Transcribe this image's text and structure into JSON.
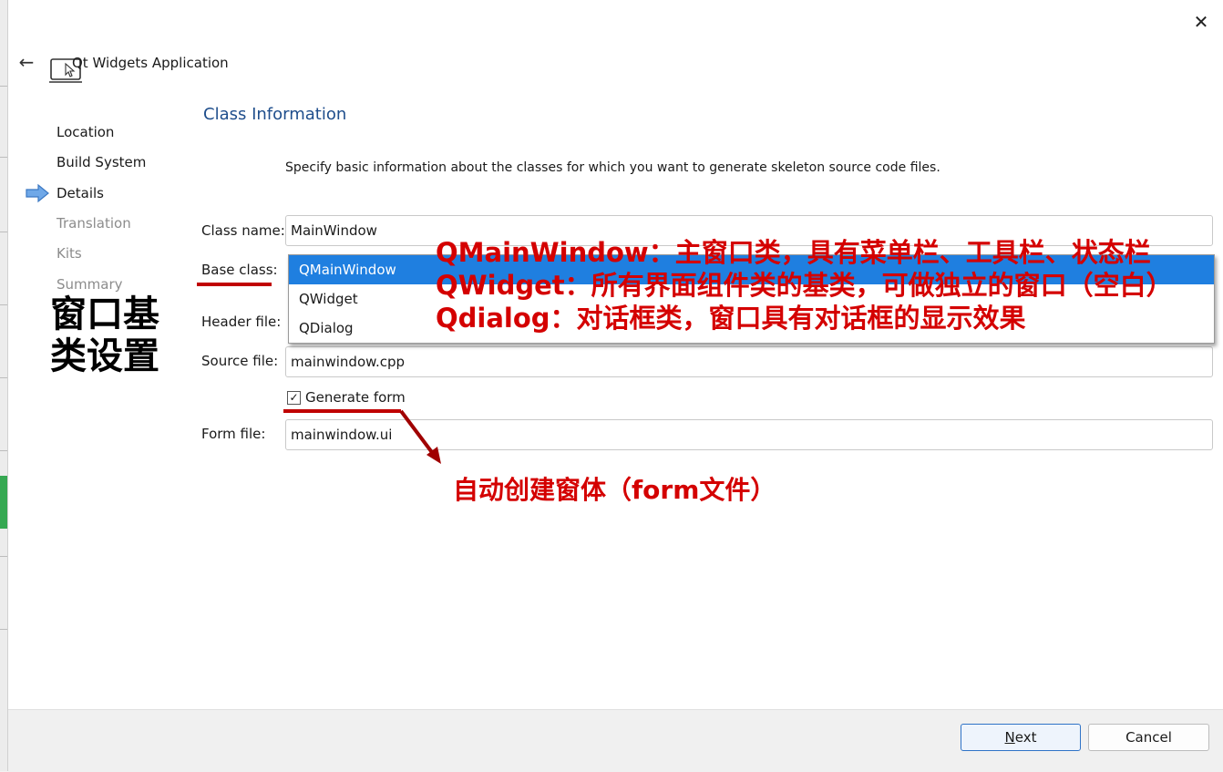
{
  "window": {
    "title": "Qt Widgets Application",
    "close_icon": "✕",
    "back_icon": "←"
  },
  "nav": {
    "items": [
      {
        "label": "Location",
        "state": "done"
      },
      {
        "label": "Build System",
        "state": "done"
      },
      {
        "label": "Details",
        "state": "current"
      },
      {
        "label": "Translation",
        "state": "pending"
      },
      {
        "label": "Kits",
        "state": "pending"
      },
      {
        "label": "Summary",
        "state": "pending"
      }
    ]
  },
  "page": {
    "title": "Class Information",
    "description": "Specify basic information about the classes for which you want to generate skeleton source code files."
  },
  "form": {
    "class_name_label": "Class name:",
    "class_name_value": "MainWindow",
    "base_class_label": "Base class:",
    "base_class_options": [
      "QMainWindow",
      "QWidget",
      "QDialog"
    ],
    "base_class_selected": "QMainWindow",
    "header_file_label": "Header file:",
    "source_file_label": "Source file:",
    "source_file_value": "mainwindow.cpp",
    "generate_form_label": "Generate form",
    "generate_form_checked": true,
    "form_file_label": "Form file:",
    "form_file_value": "mainwindow.ui"
  },
  "buttons": {
    "next_label": "ext",
    "next_mnemonic": "N",
    "cancel_label": "Cancel"
  },
  "annotations": {
    "left_title_line1": "窗口基",
    "left_title_line2": "类设置",
    "qmainwindow_note": "QMainWindow：主窗口类，具有菜单栏、工具栏、状态栏",
    "qwidget_note": "QWidget：所有界面组件类的基类，可做独立的窗口（空白）",
    "qdialog_note": "Qdialog：对话框类，窗口具有对话框的显示效果",
    "form_note": "自动创建窗体（form文件）"
  },
  "colors": {
    "accent": "#1f7fe0",
    "annotation_red": "#d40000",
    "title_blue": "#1f4e8c",
    "nav_arrow": "#4a90d9"
  }
}
